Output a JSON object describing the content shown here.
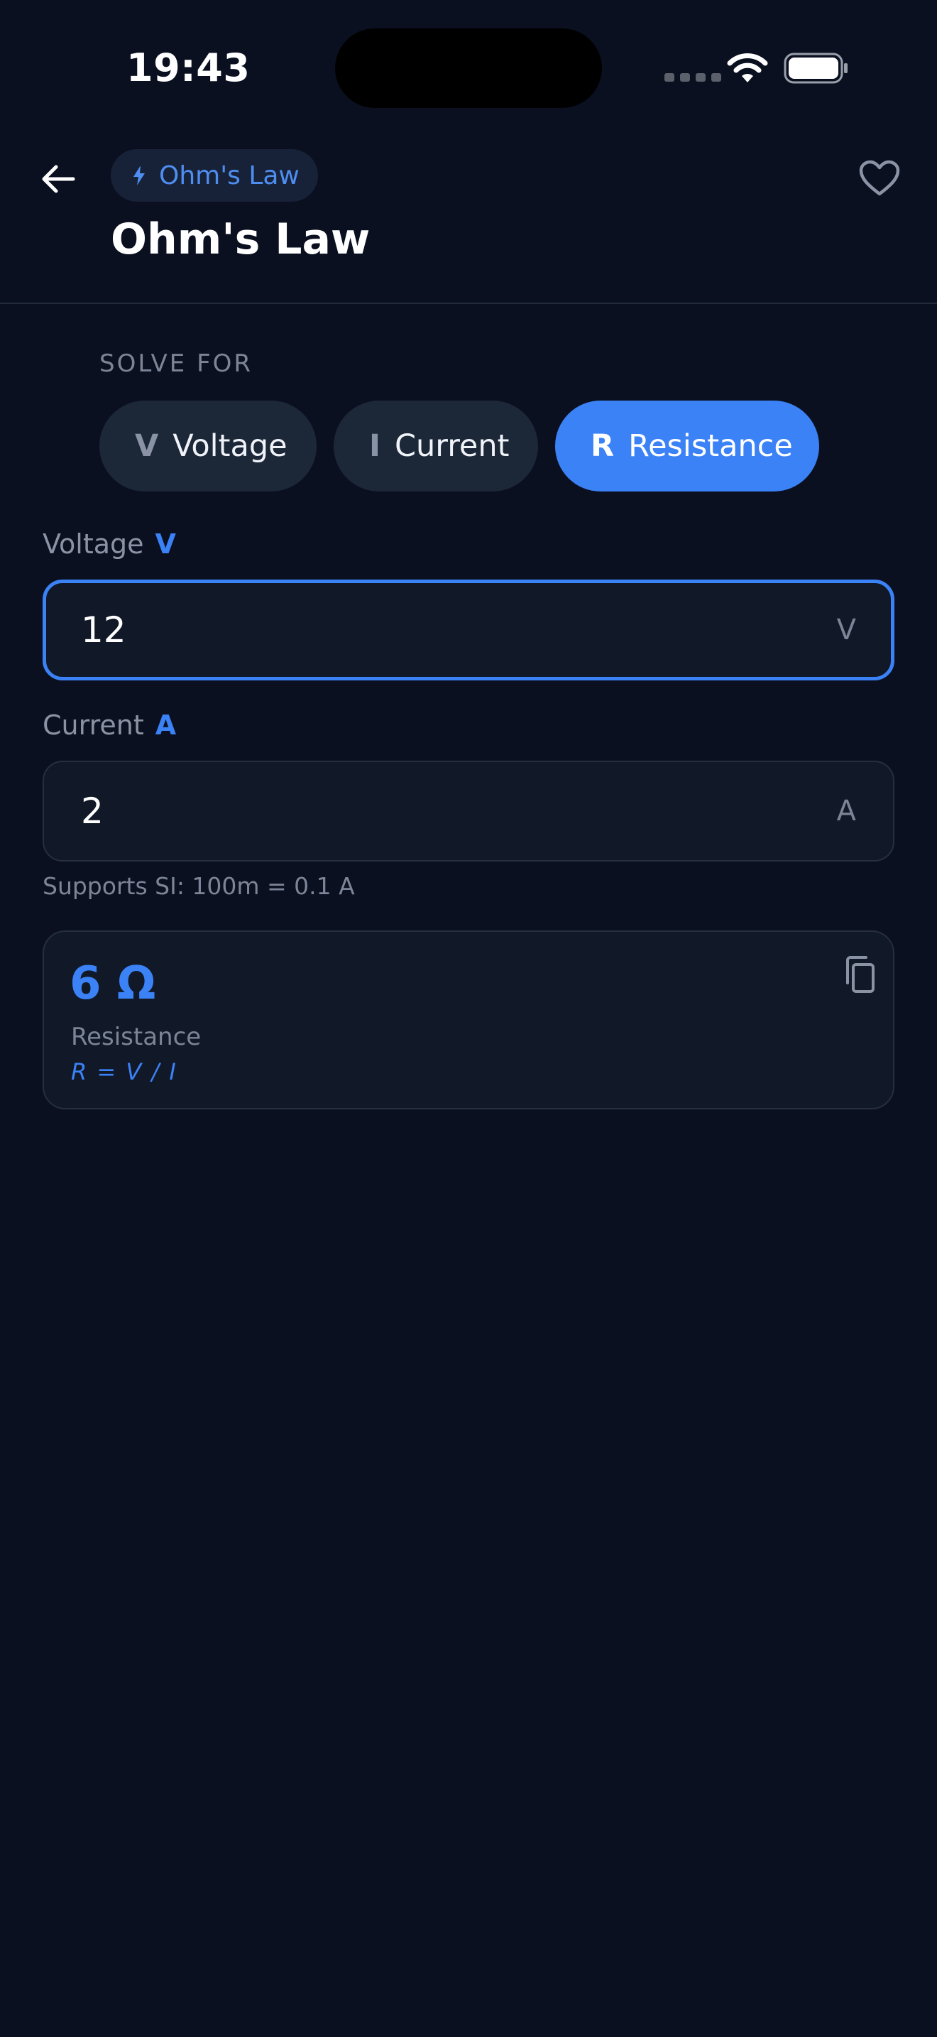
{
  "status_bar": {
    "time": "19:43"
  },
  "header": {
    "category": "Ohm's Law",
    "title": "Ohm's Law"
  },
  "solve_for": {
    "label": "SOLVE FOR",
    "options": [
      {
        "symbol": "V",
        "label": "Voltage",
        "selected": false
      },
      {
        "symbol": "I",
        "label": "Current",
        "selected": false
      },
      {
        "symbol": "R",
        "label": "Resistance",
        "selected": true
      }
    ]
  },
  "inputs": {
    "voltage": {
      "label": "Voltage",
      "symbol": "V",
      "value": "12",
      "unit": "V"
    },
    "current": {
      "label": "Current",
      "symbol": "A",
      "value": "2",
      "unit": "A"
    },
    "hint": "Supports SI: 100m = 0.1 A"
  },
  "result": {
    "value": "6 Ω",
    "label": "Resistance",
    "formula": "R = V / I"
  },
  "colors": {
    "background": "#0b1020",
    "accent": "#3b82f6",
    "card": "#111827",
    "muted_text": "#7c8597"
  },
  "icons": {
    "back": "arrow-left-icon",
    "category": "lightning-bolt-icon",
    "favorite": "heart-outline-icon",
    "copy": "copy-icon"
  }
}
